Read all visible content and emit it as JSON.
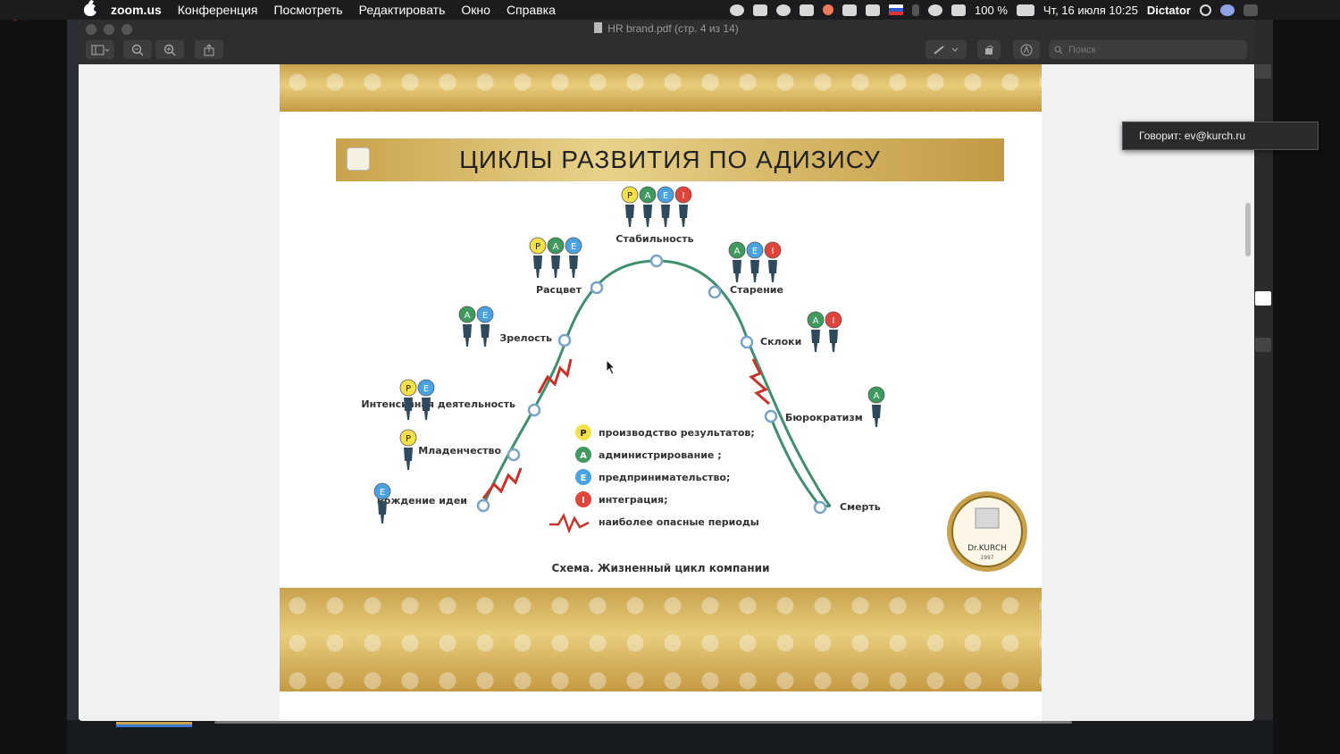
{
  "menubar": {
    "app_name": "zoom.us",
    "menus": [
      "Конференция",
      "Посмотреть",
      "Редактировать",
      "Окно",
      "Справка"
    ],
    "battery": "100 %",
    "datetime": "Чт, 16 июля 10:25",
    "user": "Dictator"
  },
  "record": {
    "label": "Запись"
  },
  "window": {
    "title": "HR brand.pdf (стр. 4 из 14)",
    "search_placeholder": "Поиск"
  },
  "tooltip": {
    "text": "Говорит: ev@kurch.ru"
  },
  "slide": {
    "title": "ЦИКЛЫ РАЗВИТИЯ ПО АДИЗИСУ",
    "caption": "Схема. Жизненный цикл компании",
    "seal_text": "Dr.KURCH",
    "seal_year": "1997",
    "stages": {
      "birth": "Рождение идеи",
      "infancy": "Младенчество",
      "intense": "Интенсивная деятельность",
      "maturity": "Зрелость",
      "prime": "Расцвет",
      "stability": "Стабильность",
      "aging": "Старение",
      "decline": "Склоки",
      "bureaucracy": "Бюрократизм",
      "death": "Смерть"
    },
    "legend": [
      {
        "letter": "P",
        "text": "производство результатов;",
        "color": "#f3e04a"
      },
      {
        "letter": "A",
        "text": "администрирование ;",
        "color": "#3f9a5e"
      },
      {
        "letter": "E",
        "text": "предпринимательство;",
        "color": "#4aa3e0"
      },
      {
        "letter": "I",
        "text": "интеграция;",
        "color": "#e0453b"
      },
      {
        "letter": "",
        "text": "наиболее опасные периоды",
        "color": "#c8322a"
      }
    ]
  },
  "colors": {
    "curve": "#3f8f6d",
    "danger": "#c8322a",
    "gold": "#d7b462"
  }
}
